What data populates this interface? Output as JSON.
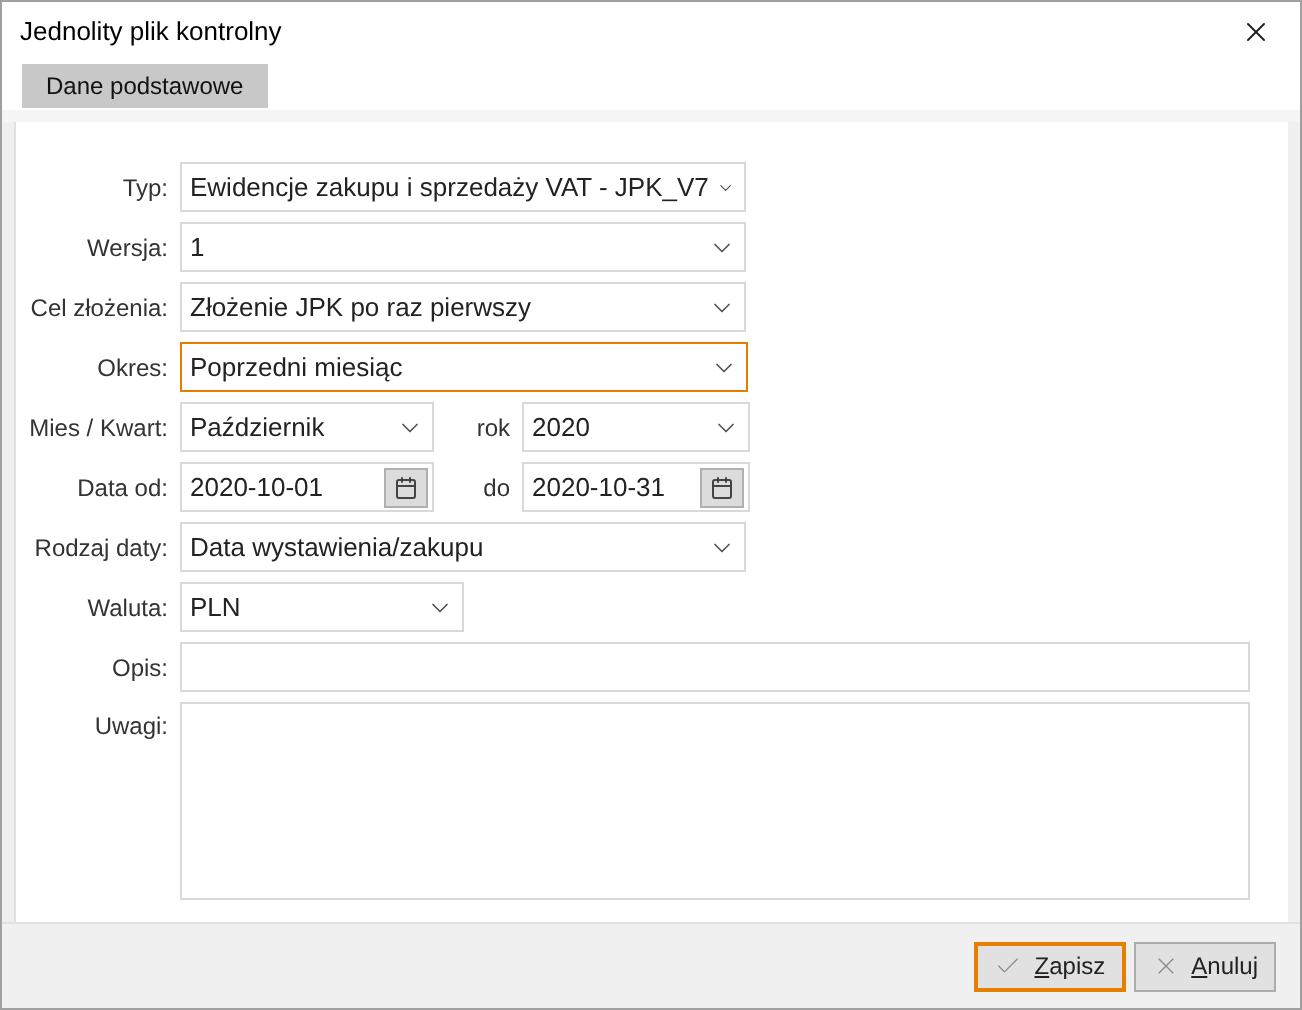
{
  "window": {
    "title": "Jednolity plik kontrolny"
  },
  "tabs": [
    {
      "label": "Dane podstawowe",
      "selected": true
    }
  ],
  "rows": [
    {
      "fields": [
        {
          "label": "Typ:",
          "value": "Ewidencje zakupu i sprzedaży VAT - JPK_V7",
          "kind": "select",
          "focused": false
        }
      ]
    },
    {
      "fields": [
        {
          "label": "Wersja:",
          "value": "1",
          "kind": "select",
          "focused": false
        }
      ]
    },
    {
      "fields": [
        {
          "label": "Cel złożenia:",
          "value": "Złożenie JPK po raz pierwszy",
          "kind": "select",
          "focused": false
        }
      ]
    },
    {
      "fields": [
        {
          "label": "Okres:",
          "value": "Poprzedni miesiąc",
          "kind": "select",
          "focused": true
        }
      ]
    },
    {
      "fields": [
        {
          "label": "Mies / Kwart:",
          "value": "Październik",
          "kind": "select",
          "focused": false
        },
        {
          "label": "rok",
          "value": "2020",
          "kind": "select",
          "focused": false
        }
      ]
    },
    {
      "fields": [
        {
          "label": "Data od:",
          "value": "2020-10-01",
          "kind": "date",
          "focused": false
        },
        {
          "label": "do",
          "value": "2020-10-31",
          "kind": "date",
          "focused": false
        }
      ]
    },
    {
      "fields": [
        {
          "label": "Rodzaj daty:",
          "value": "Data wystawienia/zakupu",
          "kind": "select",
          "focused": false
        }
      ]
    },
    {
      "fields": [
        {
          "label": "Waluta:",
          "value": "PLN",
          "kind": "select",
          "focused": false
        }
      ]
    },
    {
      "fields": [
        {
          "label": "Opis:",
          "kind": "text",
          "focused": false
        }
      ]
    },
    {
      "fields": [
        {
          "label": "Uwagi:",
          "kind": "textarea",
          "focused": false
        }
      ]
    }
  ],
  "buttons": [
    {
      "label": "Zapisz",
      "kind": "save",
      "focused": true
    },
    {
      "label": "Anuluj",
      "kind": "cancel",
      "focused": false
    }
  ]
}
